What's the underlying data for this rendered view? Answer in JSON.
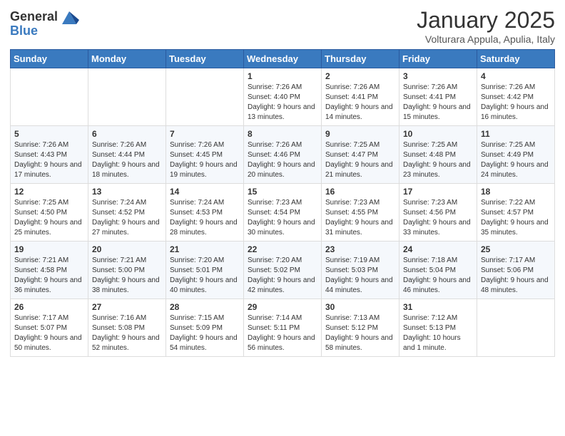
{
  "header": {
    "logo_text_general": "General",
    "logo_text_blue": "Blue",
    "month_year": "January 2025",
    "location": "Volturara Appula, Apulia, Italy"
  },
  "weekdays": [
    "Sunday",
    "Monday",
    "Tuesday",
    "Wednesday",
    "Thursday",
    "Friday",
    "Saturday"
  ],
  "weeks": [
    [
      {
        "day": "",
        "info": ""
      },
      {
        "day": "",
        "info": ""
      },
      {
        "day": "",
        "info": ""
      },
      {
        "day": "1",
        "info": "Sunrise: 7:26 AM\nSunset: 4:40 PM\nDaylight: 9 hours and 13 minutes."
      },
      {
        "day": "2",
        "info": "Sunrise: 7:26 AM\nSunset: 4:41 PM\nDaylight: 9 hours and 14 minutes."
      },
      {
        "day": "3",
        "info": "Sunrise: 7:26 AM\nSunset: 4:41 PM\nDaylight: 9 hours and 15 minutes."
      },
      {
        "day": "4",
        "info": "Sunrise: 7:26 AM\nSunset: 4:42 PM\nDaylight: 9 hours and 16 minutes."
      }
    ],
    [
      {
        "day": "5",
        "info": "Sunrise: 7:26 AM\nSunset: 4:43 PM\nDaylight: 9 hours and 17 minutes."
      },
      {
        "day": "6",
        "info": "Sunrise: 7:26 AM\nSunset: 4:44 PM\nDaylight: 9 hours and 18 minutes."
      },
      {
        "day": "7",
        "info": "Sunrise: 7:26 AM\nSunset: 4:45 PM\nDaylight: 9 hours and 19 minutes."
      },
      {
        "day": "8",
        "info": "Sunrise: 7:26 AM\nSunset: 4:46 PM\nDaylight: 9 hours and 20 minutes."
      },
      {
        "day": "9",
        "info": "Sunrise: 7:25 AM\nSunset: 4:47 PM\nDaylight: 9 hours and 21 minutes."
      },
      {
        "day": "10",
        "info": "Sunrise: 7:25 AM\nSunset: 4:48 PM\nDaylight: 9 hours and 23 minutes."
      },
      {
        "day": "11",
        "info": "Sunrise: 7:25 AM\nSunset: 4:49 PM\nDaylight: 9 hours and 24 minutes."
      }
    ],
    [
      {
        "day": "12",
        "info": "Sunrise: 7:25 AM\nSunset: 4:50 PM\nDaylight: 9 hours and 25 minutes."
      },
      {
        "day": "13",
        "info": "Sunrise: 7:24 AM\nSunset: 4:52 PM\nDaylight: 9 hours and 27 minutes."
      },
      {
        "day": "14",
        "info": "Sunrise: 7:24 AM\nSunset: 4:53 PM\nDaylight: 9 hours and 28 minutes."
      },
      {
        "day": "15",
        "info": "Sunrise: 7:23 AM\nSunset: 4:54 PM\nDaylight: 9 hours and 30 minutes."
      },
      {
        "day": "16",
        "info": "Sunrise: 7:23 AM\nSunset: 4:55 PM\nDaylight: 9 hours and 31 minutes."
      },
      {
        "day": "17",
        "info": "Sunrise: 7:23 AM\nSunset: 4:56 PM\nDaylight: 9 hours and 33 minutes."
      },
      {
        "day": "18",
        "info": "Sunrise: 7:22 AM\nSunset: 4:57 PM\nDaylight: 9 hours and 35 minutes."
      }
    ],
    [
      {
        "day": "19",
        "info": "Sunrise: 7:21 AM\nSunset: 4:58 PM\nDaylight: 9 hours and 36 minutes."
      },
      {
        "day": "20",
        "info": "Sunrise: 7:21 AM\nSunset: 5:00 PM\nDaylight: 9 hours and 38 minutes."
      },
      {
        "day": "21",
        "info": "Sunrise: 7:20 AM\nSunset: 5:01 PM\nDaylight: 9 hours and 40 minutes."
      },
      {
        "day": "22",
        "info": "Sunrise: 7:20 AM\nSunset: 5:02 PM\nDaylight: 9 hours and 42 minutes."
      },
      {
        "day": "23",
        "info": "Sunrise: 7:19 AM\nSunset: 5:03 PM\nDaylight: 9 hours and 44 minutes."
      },
      {
        "day": "24",
        "info": "Sunrise: 7:18 AM\nSunset: 5:04 PM\nDaylight: 9 hours and 46 minutes."
      },
      {
        "day": "25",
        "info": "Sunrise: 7:17 AM\nSunset: 5:06 PM\nDaylight: 9 hours and 48 minutes."
      }
    ],
    [
      {
        "day": "26",
        "info": "Sunrise: 7:17 AM\nSunset: 5:07 PM\nDaylight: 9 hours and 50 minutes."
      },
      {
        "day": "27",
        "info": "Sunrise: 7:16 AM\nSunset: 5:08 PM\nDaylight: 9 hours and 52 minutes."
      },
      {
        "day": "28",
        "info": "Sunrise: 7:15 AM\nSunset: 5:09 PM\nDaylight: 9 hours and 54 minutes."
      },
      {
        "day": "29",
        "info": "Sunrise: 7:14 AM\nSunset: 5:11 PM\nDaylight: 9 hours and 56 minutes."
      },
      {
        "day": "30",
        "info": "Sunrise: 7:13 AM\nSunset: 5:12 PM\nDaylight: 9 hours and 58 minutes."
      },
      {
        "day": "31",
        "info": "Sunrise: 7:12 AM\nSunset: 5:13 PM\nDaylight: 10 hours and 1 minute."
      },
      {
        "day": "",
        "info": ""
      }
    ]
  ]
}
